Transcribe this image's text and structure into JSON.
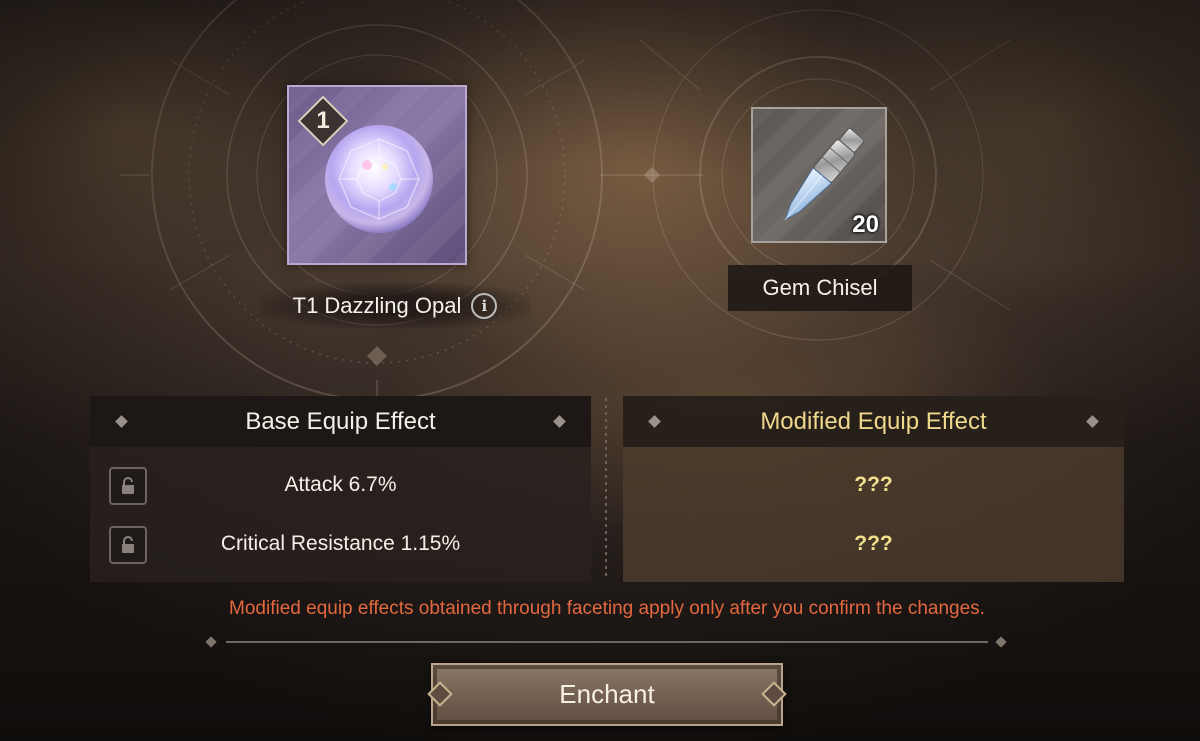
{
  "colors": {
    "accent_gold": "#efd78c",
    "warning_text": "#e3683f",
    "gem_slot_bg": "#7a6a9a"
  },
  "gem": {
    "name": "T1 Dazzling Opal",
    "tier": "1",
    "icon": "opal-gem-icon",
    "info_icon": "info-icon"
  },
  "material": {
    "name": "Gem Chisel",
    "count": "20",
    "icon": "gem-chisel-icon"
  },
  "base_effect": {
    "title": "Base Equip Effect",
    "rows": [
      {
        "text": "Attack 6.7%",
        "icon": "lock-icon"
      },
      {
        "text": "Critical Resistance 1.15%",
        "icon": "lock-icon"
      }
    ]
  },
  "modified_effect": {
    "title": "Modified Equip Effect",
    "rows": [
      {
        "text": "???"
      },
      {
        "text": "???"
      }
    ]
  },
  "notice": "Modified equip effects obtained through faceting apply only after you confirm the changes.",
  "actions": {
    "enchant_label": "Enchant"
  }
}
